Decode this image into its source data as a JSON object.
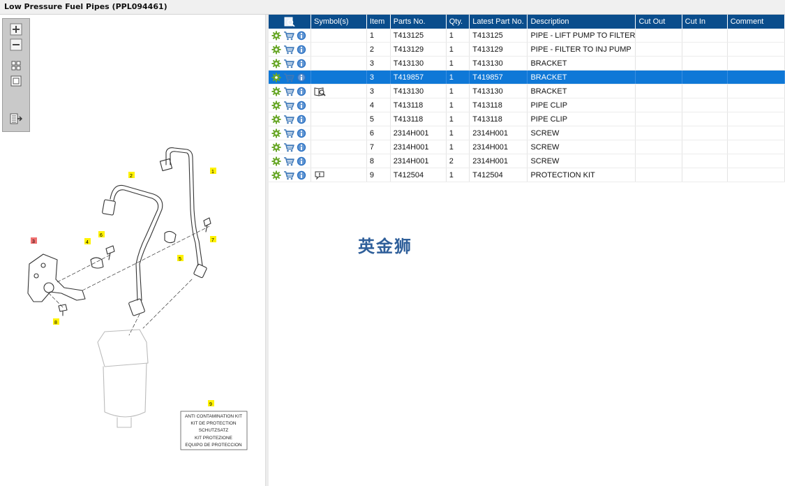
{
  "window": {
    "title": "Low Pressure Fuel Pipes (PPL094461)"
  },
  "toolbox": {
    "buttons": [
      "zoom-in-icon",
      "zoom-out-icon",
      "fit-all-icon",
      "fit-window-icon",
      "list-export-icon"
    ]
  },
  "diagram": {
    "callouts": [
      "1",
      "2",
      "3",
      "4",
      "5",
      "6",
      "7",
      "8",
      "9"
    ],
    "kit_label_lines": [
      "ANTI CONTAMINATION KIT",
      "KIT DE PROTECTION",
      "SCHUTZSATZ",
      "KIT PROTEZIONE",
      "EQUIPO DE PROTECCION"
    ]
  },
  "table": {
    "headers": [
      "",
      "Symbol(s)",
      "Item",
      "Parts No.",
      "Qty.",
      "Latest Part No.",
      "Description",
      "Cut Out",
      "Cut In",
      "Comment"
    ],
    "rows": [
      {
        "symbol": "",
        "item": "1",
        "part": "T413125",
        "qty": "1",
        "latest": "T413125",
        "desc": "PIPE - LIFT PUMP TO FILTER",
        "cut_out": "",
        "cut_in": "",
        "comment": ""
      },
      {
        "symbol": "",
        "item": "2",
        "part": "T413129",
        "qty": "1",
        "latest": "T413129",
        "desc": "PIPE - FILTER TO INJ PUMP",
        "cut_out": "",
        "cut_in": "",
        "comment": ""
      },
      {
        "symbol": "",
        "item": "3",
        "part": "T413130",
        "qty": "1",
        "latest": "T413130",
        "desc": "BRACKET",
        "cut_out": "",
        "cut_in": "",
        "comment": ""
      },
      {
        "symbol": "",
        "item": "3",
        "part": "T419857",
        "qty": "1",
        "latest": "T419857",
        "desc": "BRACKET",
        "cut_out": "",
        "cut_in": "",
        "comment": "",
        "selected": true
      },
      {
        "symbol": "book-search-icon",
        "item": "3",
        "part": "T413130",
        "qty": "1",
        "latest": "T413130",
        "desc": "BRACKET",
        "cut_out": "",
        "cut_in": "",
        "comment": ""
      },
      {
        "symbol": "",
        "item": "4",
        "part": "T413118",
        "qty": "1",
        "latest": "T413118",
        "desc": "PIPE CLIP",
        "cut_out": "",
        "cut_in": "",
        "comment": ""
      },
      {
        "symbol": "",
        "item": "5",
        "part": "T413118",
        "qty": "1",
        "latest": "T413118",
        "desc": "PIPE CLIP",
        "cut_out": "",
        "cut_in": "",
        "comment": ""
      },
      {
        "symbol": "",
        "item": "6",
        "part": "2314H001",
        "qty": "1",
        "latest": "2314H001",
        "desc": "SCREW",
        "cut_out": "",
        "cut_in": "",
        "comment": ""
      },
      {
        "symbol": "",
        "item": "7",
        "part": "2314H001",
        "qty": "1",
        "latest": "2314H001",
        "desc": "SCREW",
        "cut_out": "",
        "cut_in": "",
        "comment": ""
      },
      {
        "symbol": "",
        "item": "8",
        "part": "2314H001",
        "qty": "2",
        "latest": "2314H001",
        "desc": "SCREW",
        "cut_out": "",
        "cut_in": "",
        "comment": ""
      },
      {
        "symbol": "comment-icon",
        "item": "9",
        "part": "T412504",
        "qty": "1",
        "latest": "T412504",
        "desc": "PROTECTION KIT",
        "cut_out": "",
        "cut_in": "",
        "comment": ""
      }
    ]
  },
  "watermark": "英金狮",
  "colors": {
    "header_bg": "#0a4d8c",
    "selected_row": "#0f78d7",
    "gear": "#6aa82a",
    "info": "#2d73c4",
    "cart": "#3e78b8"
  }
}
